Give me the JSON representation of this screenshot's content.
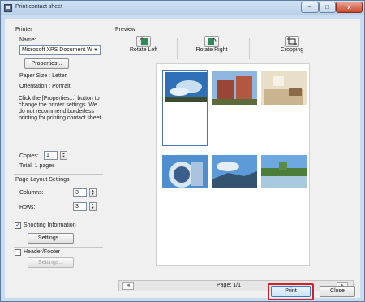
{
  "window": {
    "title": "Print contact sheet"
  },
  "titlebar": {
    "minimize_glyph": "–",
    "maximize_glyph": "□",
    "close_glyph": "x"
  },
  "printer": {
    "section_label": "Printer",
    "name_label": "Name:",
    "selected_printer": "Microsoft XPS Document W",
    "properties_button": "Properties...",
    "paper_size": "Paper Size : Letter",
    "orientation": "Orientation : Portrait",
    "note": "Click the [Properties...] button to change the printer settings. We do not recommend borderless printing for printing contact sheet."
  },
  "copies": {
    "label": "Copies:",
    "value": "1",
    "total": "Total: 1 pages"
  },
  "layout": {
    "section_label": "Page Layout Settings",
    "columns_label": "Columns:",
    "columns_value": "3",
    "rows_label": "Rows:",
    "rows_value": "3"
  },
  "shooting_info": {
    "label": "Shooting Information",
    "checked": true,
    "settings_button": "Settings..."
  },
  "header_footer": {
    "label": "Header/Footer",
    "checked": false,
    "settings_button": "Settings..."
  },
  "preview": {
    "label": "Preview",
    "toolbar": [
      {
        "label": "Rotate Left",
        "icon": "rotate-left-icon"
      },
      {
        "label": "Rotate Right",
        "icon": "rotate-right-icon"
      },
      {
        "label": "Cropping",
        "icon": "crop-icon"
      }
    ],
    "thumbnails": [
      {
        "subject": "sky and clouds",
        "colors": [
          "#2f6fb8",
          "#c8dff2",
          "#3b4d2e"
        ]
      },
      {
        "subject": "red brick building",
        "colors": [
          "#8fb6de",
          "#9a4535",
          "#5c6b3a"
        ]
      },
      {
        "subject": "living room interior",
        "colors": [
          "#e9dfc9",
          "#8a6a48",
          "#c9b48f"
        ]
      },
      {
        "subject": "blue round building",
        "colors": [
          "#4f8fd0",
          "#d8e7f3",
          "#3b5f8a"
        ]
      },
      {
        "subject": "stadium under sky",
        "colors": [
          "#5d9bd8",
          "#e6eef5",
          "#34536e"
        ]
      },
      {
        "subject": "lake and trees",
        "colors": [
          "#6ea8e0",
          "#4c7d3b",
          "#a9c9de"
        ]
      }
    ],
    "selected_index": 0
  },
  "navigation": {
    "prev_glyph": "◄",
    "next_glyph": "►",
    "page_label": "Page: 1/1"
  },
  "footer": {
    "print_button": "Print",
    "close_button": "Close"
  },
  "accent": {
    "highlight": "#d0202a",
    "selection": "#4c76b3"
  }
}
